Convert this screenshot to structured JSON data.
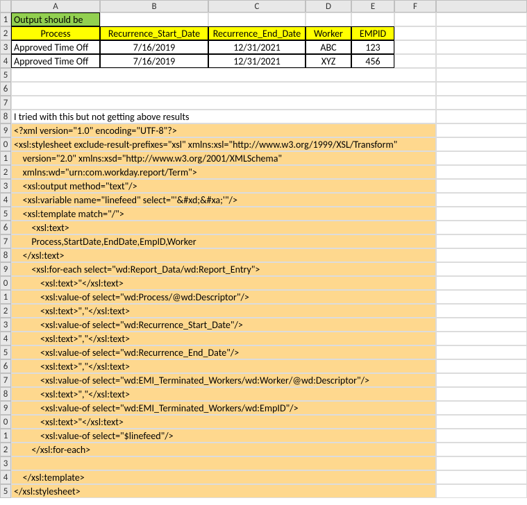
{
  "cols": [
    "A",
    "B",
    "C",
    "D",
    "E",
    "F"
  ],
  "rows": [
    "1",
    "2",
    "3",
    "4",
    "5",
    "6",
    "7",
    "8",
    "9",
    "0",
    "1",
    "2",
    "3",
    "4",
    "5",
    "6",
    "7",
    "8",
    "9",
    "0",
    "1",
    "2",
    "3",
    "4",
    "5",
    "6",
    "7",
    "8",
    "9",
    "0",
    "1",
    "2",
    "3",
    "4",
    "5"
  ],
  "header_green": "Output should be",
  "table": {
    "headers": [
      "Process",
      "Recurrence_Start_Date",
      "Recurrence_End_Date",
      "Worker",
      "EMPID"
    ],
    "rows": [
      [
        "Approved Time Off",
        "7/16/2019",
        "12/31/2021",
        "ABC",
        "123"
      ],
      [
        "Approved Time Off",
        "7/16/2019",
        "12/31/2021",
        "XYZ",
        "456"
      ]
    ]
  },
  "note": "I tried with this but not getting above results",
  "code": [
    "<?xml version=\"1.0\" encoding=\"UTF-8\"?>",
    "<xsl:stylesheet exclude-result-prefixes=\"xsl\" xmlns:xsl=\"http://www.w3.org/1999/XSL/Transform\"",
    "    version=\"2.0\" xmlns:xsd=\"http://www.w3.org/2001/XMLSchema\"",
    "    xmlns:wd=\"urn:com.workday.report/Term\">",
    "    <xsl:output method=\"text\"/>",
    "    <xsl:variable name=\"linefeed\" select=\"'&#xd;&#xa;'\"/>",
    "    <xsl:template match=\"/\">",
    "        <xsl:text>",
    "        Process,StartDate,EndDate,EmpID,Worker",
    "    </xsl:text>",
    "        <xsl:for-each select=\"wd:Report_Data/wd:Report_Entry\">",
    "            <xsl:text>\"</xsl:text>",
    "            <xsl:value-of select=\"wd:Process/@wd:Descriptor\"/>",
    "            <xsl:text>\",\"</xsl:text>",
    "            <xsl:value-of select=\"wd:Recurrence_Start_Date\"/>",
    "            <xsl:text>\",\"</xsl:text>",
    "            <xsl:value-of select=\"wd:Recurrence_End_Date\"/>",
    "            <xsl:text>\",\"</xsl:text>",
    "            <xsl:value-of select=\"wd:EMI_Terminated_Workers/wd:Worker/@wd:Descriptor\"/>",
    "            <xsl:text>\",\"</xsl:text>",
    "            <xsl:value-of select=\"wd:EMI_Terminated_Workers/wd:EmpID\"/>",
    "            <xsl:text>\"</xsl:text>",
    "            <xsl:value-of select=\"$linefeed\"/>",
    "        </xsl:for-each>",
    "",
    "    </xsl:template>",
    "</xsl:stylesheet>"
  ]
}
